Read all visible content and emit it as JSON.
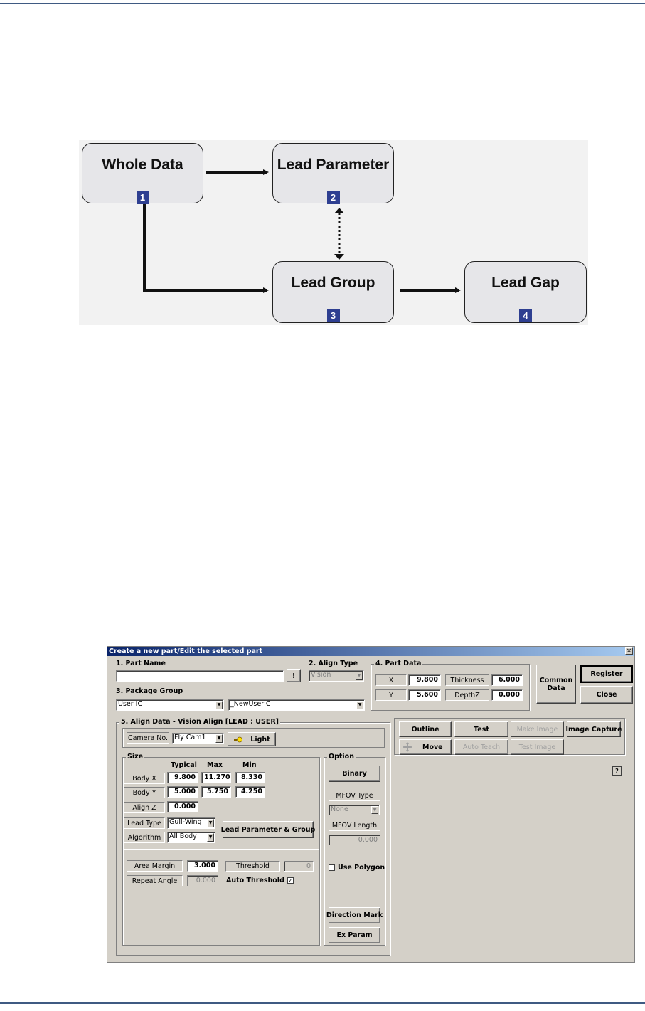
{
  "diagram": {
    "boxes": [
      {
        "title": "Whole Data",
        "num": "1"
      },
      {
        "title": "Lead Parameter",
        "num": "2"
      },
      {
        "title": "Lead Group",
        "num": "3"
      },
      {
        "title": "Lead Gap",
        "num": "4"
      }
    ]
  },
  "dialog": {
    "title": "Create a new part/Edit the selected part",
    "close_glyph": "×",
    "part_name": {
      "label": "1. Part Name",
      "value": "",
      "bang": "!"
    },
    "align_type": {
      "label": "2. Align Type",
      "value": "Vision"
    },
    "package_group": {
      "label": "3. Package Group",
      "group": "User IC",
      "package": "_NewUserIC"
    },
    "part_data": {
      "label": "4. Part Data",
      "x_label": "X",
      "x": "9.800",
      "y_label": "Y",
      "y": "5.600",
      "thickness_label": "Thickness",
      "thickness": "6.000",
      "depth_label": "DepthZ",
      "depth": "0.000"
    },
    "buttons": {
      "common_data": "Common Data",
      "register": "Register",
      "close": "Close"
    },
    "align_data": {
      "label": "5. Align Data - Vision Align [LEAD : USER]",
      "camera_label": "Camera No.",
      "camera": "Fly Cam1",
      "light": "Light",
      "size": {
        "label": "Size",
        "col_typical": "Typical",
        "col_max": "Max",
        "col_min": "Min",
        "body_x": {
          "label": "Body X",
          "typical": "9.800",
          "max": "11.270",
          "min": "8.330"
        },
        "body_y": {
          "label": "Body Y",
          "typical": "5.000",
          "max": "5.750",
          "min": "4.250"
        },
        "align_z": {
          "label": "Align Z",
          "typical": "0.000"
        },
        "lead_type_label": "Lead Type",
        "lead_type": "Gull-Wing",
        "algorithm_label": "Algorithm",
        "algorithm": "All Body",
        "lead_param_btn": "Lead Parameter & Group",
        "area_margin_label": "Area Margin",
        "area_margin": "3.000",
        "threshold_label": "Threshold",
        "threshold": "0",
        "repeat_angle_label": "Repeat Angle",
        "repeat_angle": "0.000",
        "auto_threshold_label": "Auto Threshold",
        "auto_threshold_mark": "✓"
      },
      "option": {
        "label": "Option",
        "binary": "Binary",
        "mfov_type_label": "MFOV Type",
        "mfov_type": "None",
        "mfov_length_label": "MFOV Length",
        "mfov_length": "0.000",
        "use_polygon": "Use Polygon",
        "direction_mark": "Direction Mark",
        "ex_param": "Ex Param"
      }
    },
    "toolbar": {
      "outline": "Outline",
      "test": "Test",
      "make_image": "Make Image",
      "image_capture": "Image Capture",
      "move": "Move",
      "auto_teach": "Auto Teach",
      "test_image": "Test Image"
    },
    "help": "?"
  }
}
